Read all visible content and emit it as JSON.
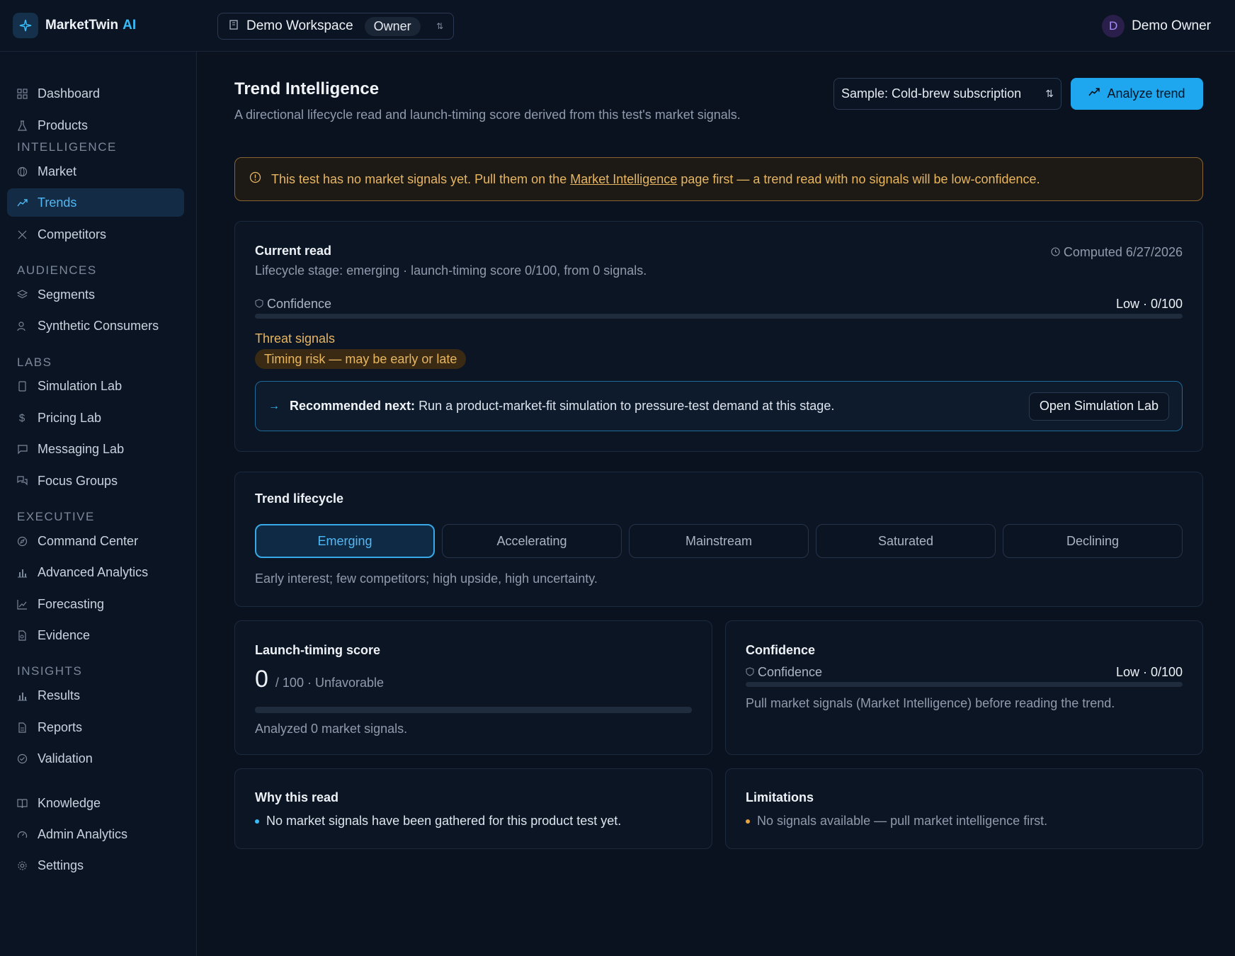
{
  "header": {
    "brand_name": "MarketTwin",
    "brand_ai": "AI",
    "workspace_name": "Demo Workspace",
    "workspace_role": "Owner",
    "user_initial": "D",
    "user_name": "Demo Owner"
  },
  "sidebar": {
    "items": [
      {
        "label": "Dashboard",
        "icon": "grid-icon"
      },
      {
        "label": "Products",
        "icon": "flask-icon"
      }
    ],
    "sections": [
      {
        "title": "INTELLIGENCE",
        "items": [
          {
            "label": "Market",
            "icon": "globe-icon"
          },
          {
            "label": "Trends",
            "icon": "trending-up-icon",
            "active": true
          },
          {
            "label": "Competitors",
            "icon": "swords-icon"
          }
        ]
      },
      {
        "title": "AUDIENCES",
        "items": [
          {
            "label": "Segments",
            "icon": "layers-icon"
          },
          {
            "label": "Synthetic Consumers",
            "icon": "users-icon"
          }
        ]
      },
      {
        "title": "LABS",
        "items": [
          {
            "label": "Simulation Lab",
            "icon": "beaker-icon"
          },
          {
            "label": "Pricing Lab",
            "icon": "dollar-icon"
          },
          {
            "label": "Messaging Lab",
            "icon": "message-icon"
          },
          {
            "label": "Focus Groups",
            "icon": "chat-icon"
          }
        ]
      },
      {
        "title": "EXECUTIVE",
        "items": [
          {
            "label": "Command Center",
            "icon": "compass-icon"
          },
          {
            "label": "Advanced Analytics",
            "icon": "bar-chart-icon"
          },
          {
            "label": "Forecasting",
            "icon": "line-chart-icon"
          },
          {
            "label": "Evidence",
            "icon": "file-search-icon"
          }
        ]
      },
      {
        "title": "INSIGHTS",
        "items": [
          {
            "label": "Results",
            "icon": "bar-chart-icon"
          },
          {
            "label": "Reports",
            "icon": "file-icon"
          },
          {
            "label": "Validation",
            "icon": "check-circle-icon"
          }
        ]
      }
    ],
    "footer_items": [
      {
        "label": "Knowledge",
        "icon": "book-icon"
      },
      {
        "label": "Admin Analytics",
        "icon": "gauge-icon"
      },
      {
        "label": "Settings",
        "icon": "gear-icon"
      }
    ]
  },
  "page": {
    "title": "Trend Intelligence",
    "subtitle": "A directional lifecycle read and launch-timing score derived from this test's market signals.",
    "sample_select": "Sample: Cold-brew subscription",
    "analyze_button": "Analyze trend"
  },
  "warning": {
    "prefix": "This test has no market signals yet. Pull them on the",
    "link": "Market Intelligence",
    "suffix": "page first — a trend read with no signals will be low-confidence."
  },
  "current_read": {
    "title": "Current read",
    "computed": "Computed 6/27/2026",
    "summary": "Lifecycle stage: emerging · launch-timing score 0/100, from 0 signals.",
    "confidence_label": "Confidence",
    "confidence_value": "Low · 0/100",
    "confidence_level": 0,
    "threat_title": "Threat signals",
    "threat_chip": "Timing risk — may be early or late",
    "reco_label": "Recommended next:",
    "reco_text": "Run a product-market-fit simulation to pressure-test demand at this stage.",
    "reco_button": "Open Simulation Lab"
  },
  "lifecycle": {
    "title": "Trend lifecycle",
    "stages": [
      "Emerging",
      "Accelerating",
      "Mainstream",
      "Saturated",
      "Declining"
    ],
    "active_index": 0,
    "description": "Early interest; few competitors; high upside, high uncertainty."
  },
  "launch_timing": {
    "title": "Launch-timing score",
    "score": "0",
    "score_suffix": "/ 100 · Unfavorable",
    "score_level": 0,
    "note": "Analyzed 0 market signals."
  },
  "confidence_card": {
    "title": "Confidence",
    "label": "Confidence",
    "value": "Low · 0/100",
    "level": 0,
    "note": "Pull market signals (Market Intelligence) before reading the trend."
  },
  "why": {
    "title": "Why this read",
    "bullets": [
      "No market signals have been gathered for this product test yet."
    ]
  },
  "limitations": {
    "title": "Limitations",
    "bullets": [
      "No signals available — pull market intelligence first."
    ]
  },
  "colors": {
    "accent": "#38bdf8",
    "warning": "#e8b661",
    "background": "#0a1220"
  }
}
